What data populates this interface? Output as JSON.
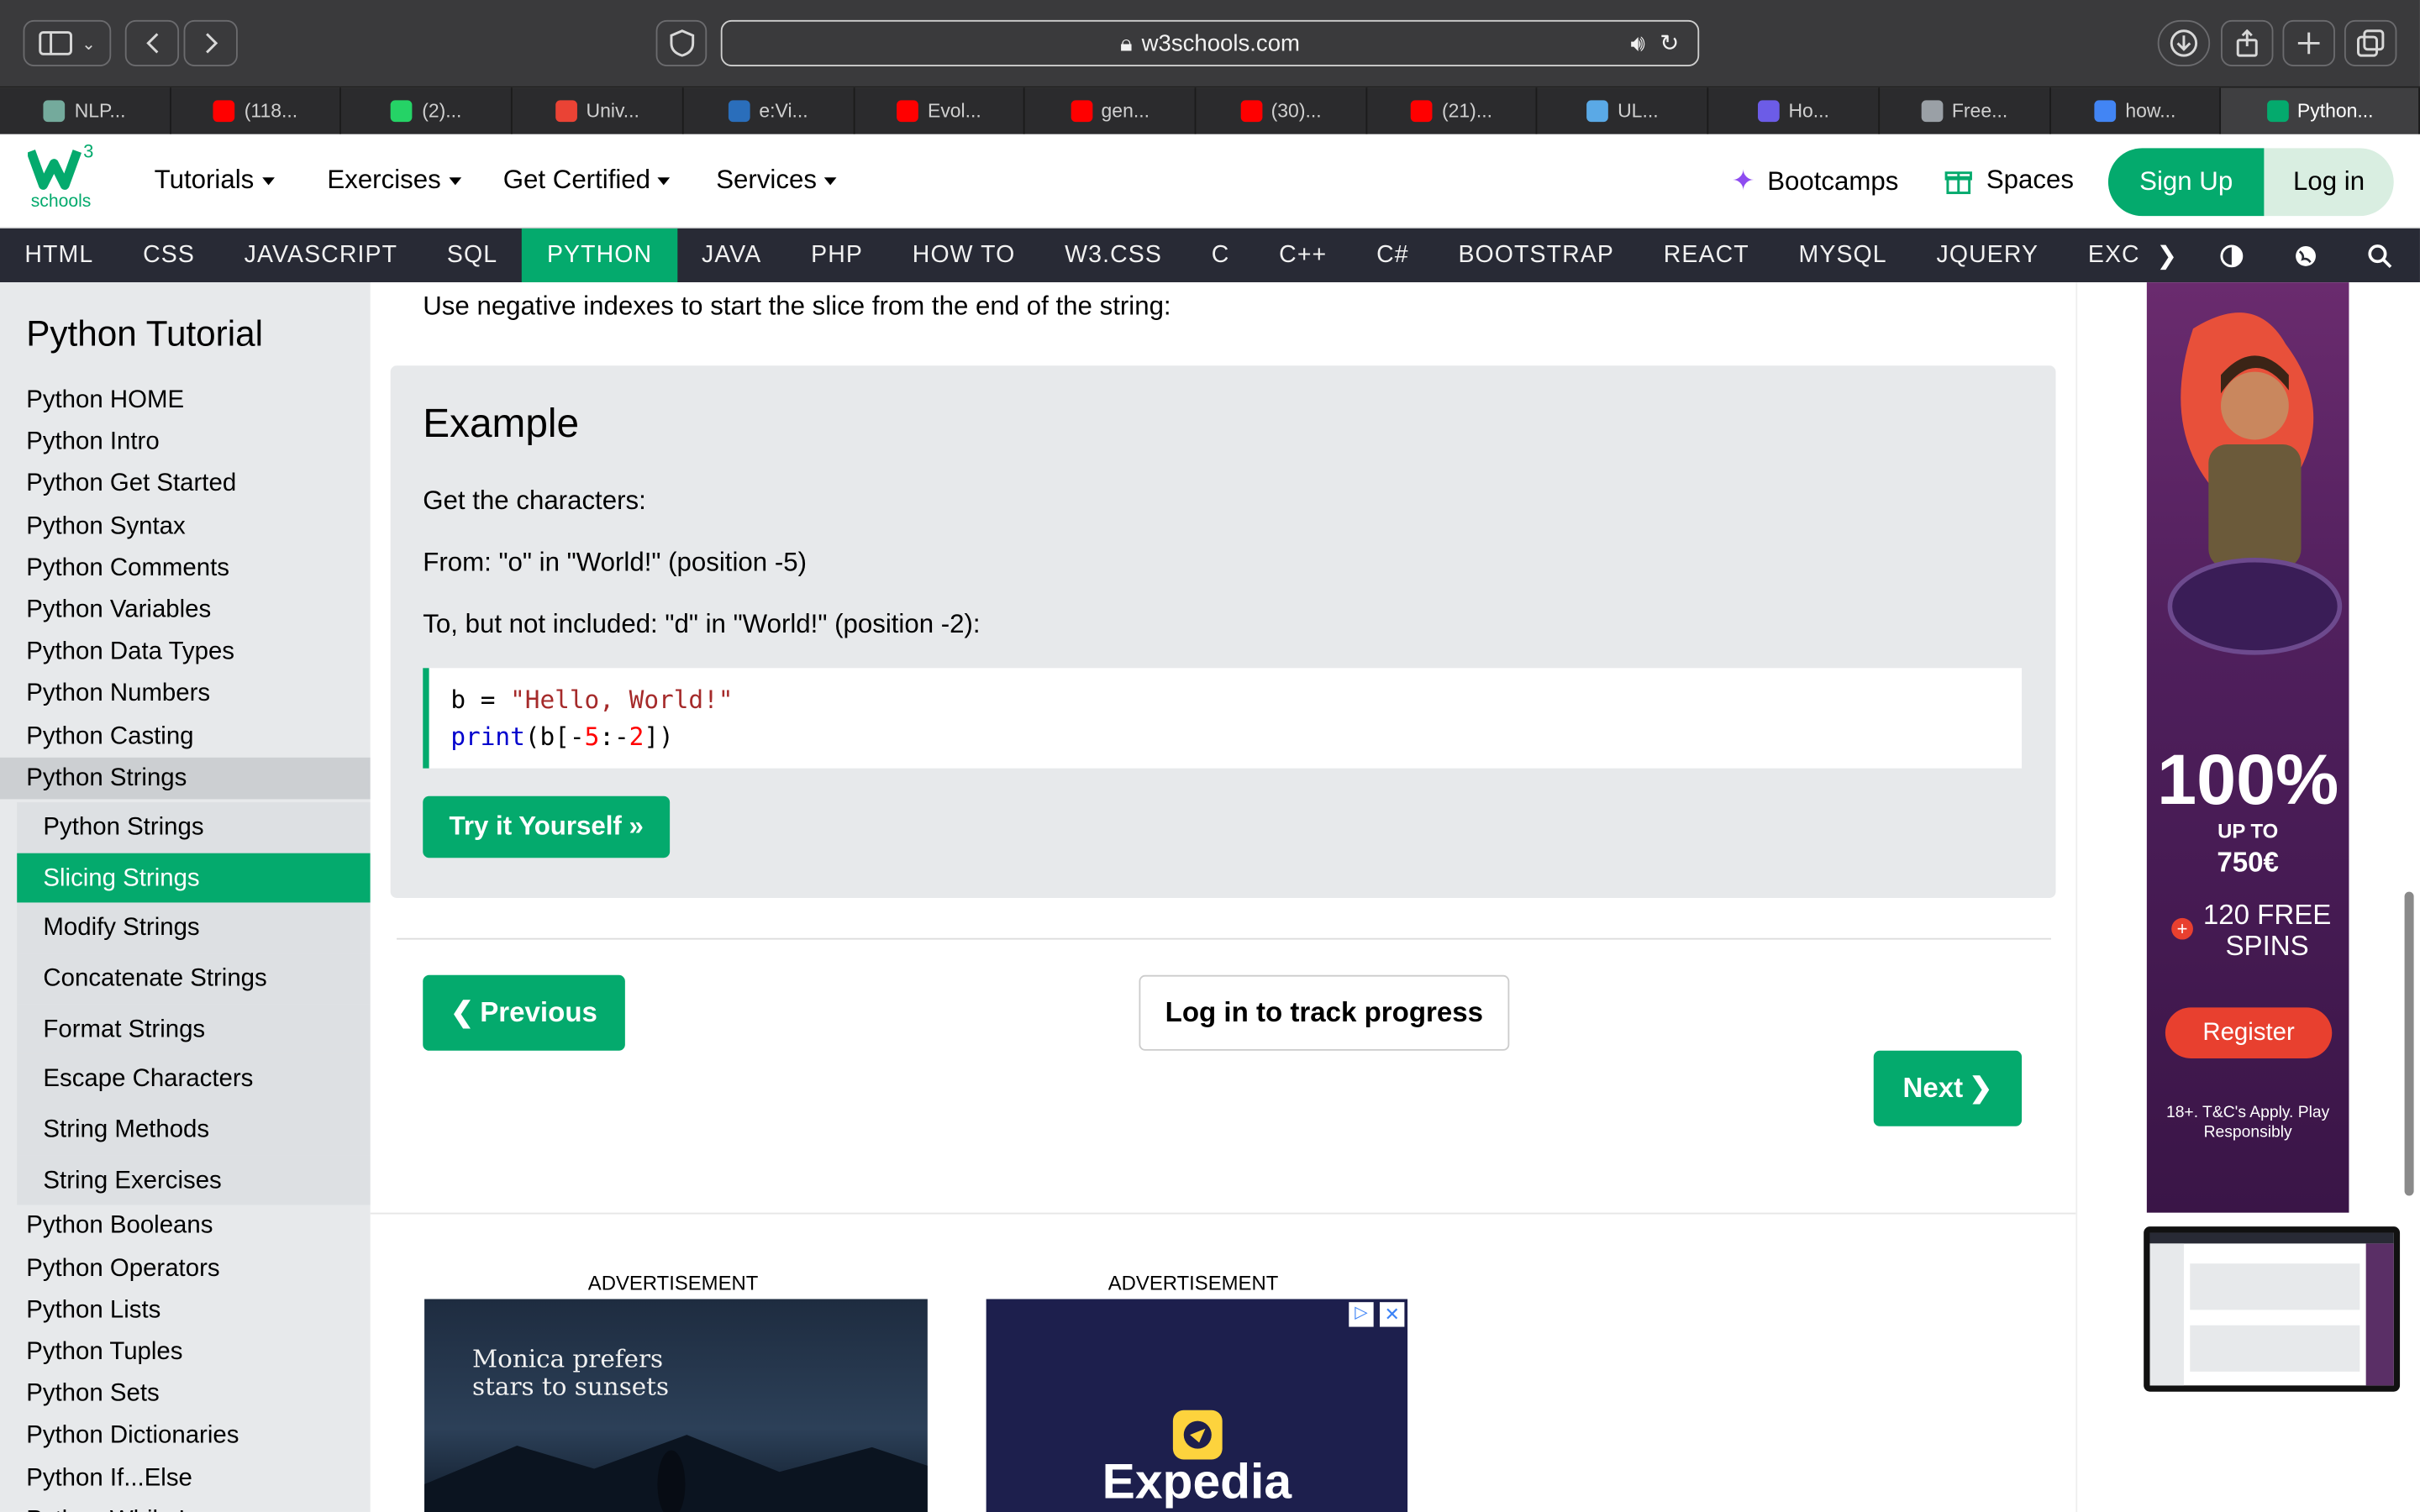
{
  "browser": {
    "url": "w3schools.com",
    "tabs": [
      {
        "label": "NLP...",
        "color": "#74aa9c"
      },
      {
        "label": "(118...",
        "color": "#ff0000"
      },
      {
        "label": "(2)...",
        "color": "#25d366"
      },
      {
        "label": "Univ...",
        "color": "#ea4335"
      },
      {
        "label": "e:Vi...",
        "color": "#2a6ebb"
      },
      {
        "label": "Evol...",
        "color": "#ff0000"
      },
      {
        "label": "gen...",
        "color": "#ff0000"
      },
      {
        "label": "(30)...",
        "color": "#ff0000"
      },
      {
        "label": "(21)...",
        "color": "#ff0000"
      },
      {
        "label": "UL...",
        "color": "#5aa9e6"
      },
      {
        "label": "Ho...",
        "color": "#6c5ce7"
      },
      {
        "label": "Free...",
        "color": "#9aa0a6"
      },
      {
        "label": "how...",
        "color": "#4285f4"
      },
      {
        "label": "Python...",
        "color": "#04aa6d"
      }
    ]
  },
  "header": {
    "logo_text": "schools",
    "logo_sup": "3",
    "nav": [
      "Tutorials",
      "Exercises",
      "Get Certified",
      "Services"
    ],
    "bootcamps": "Bootcamps",
    "spaces": "Spaces",
    "signup": "Sign Up",
    "login": "Log in"
  },
  "topnav": [
    "HTML",
    "CSS",
    "JAVASCRIPT",
    "SQL",
    "PYTHON",
    "JAVA",
    "PHP",
    "HOW TO",
    "W3.CSS",
    "C",
    "C++",
    "C#",
    "BOOTSTRAP",
    "REACT",
    "MYSQL",
    "JQUERY",
    "EXCEL"
  ],
  "topnav_active": "PYTHON",
  "sidebar": {
    "title": "Python Tutorial",
    "items_before": [
      "Python HOME",
      "Python Intro",
      "Python Get Started",
      "Python Syntax",
      "Python Comments",
      "Python Variables",
      "Python Data Types",
      "Python Numbers",
      "Python Casting"
    ],
    "group": "Python Strings",
    "sub": [
      "Python Strings",
      "Slicing Strings",
      "Modify Strings",
      "Concatenate Strings",
      "Format Strings",
      "Escape Characters",
      "String Methods",
      "String Exercises"
    ],
    "sub_active": "Slicing Strings",
    "items_after": [
      "Python Booleans",
      "Python Operators",
      "Python Lists",
      "Python Tuples",
      "Python Sets",
      "Python Dictionaries",
      "Python If...Else",
      "Python While Loops"
    ]
  },
  "main": {
    "intro": "Use negative indexes to start the slice from the end of the string:",
    "example_title": "Example",
    "p1": "Get the characters:",
    "p2": "From: \"o\" in \"World!\" (position -5)",
    "p3": "To, but not included: \"d\" in \"World!\" (position -2):",
    "code_line1_var": "b = ",
    "code_line1_str": "\"Hello, World!\"",
    "code_line2_fn": "print",
    "code_line2_a": "(b[-",
    "code_line2_n1": "5",
    "code_line2_b": ":-",
    "code_line2_n2": "2",
    "code_line2_c": "])",
    "try_button": "Try it Yourself »",
    "prev_button": "Previous",
    "track_button": "Log in to track progress",
    "next_button": "Next",
    "ad_label_1": "ADVERTISEMENT",
    "ad_label_2": "ADVERTISEMENT",
    "ad1_text": "Monica prefers stars to sunsets",
    "ad2_brand": "Expedia"
  },
  "side_ad": {
    "big": "100%",
    "upto": "UP TO",
    "amount": "750€",
    "spins": "120 FREE SPINS",
    "register": "Register",
    "terms": "18+. T&C's Apply. Play Responsibly"
  }
}
